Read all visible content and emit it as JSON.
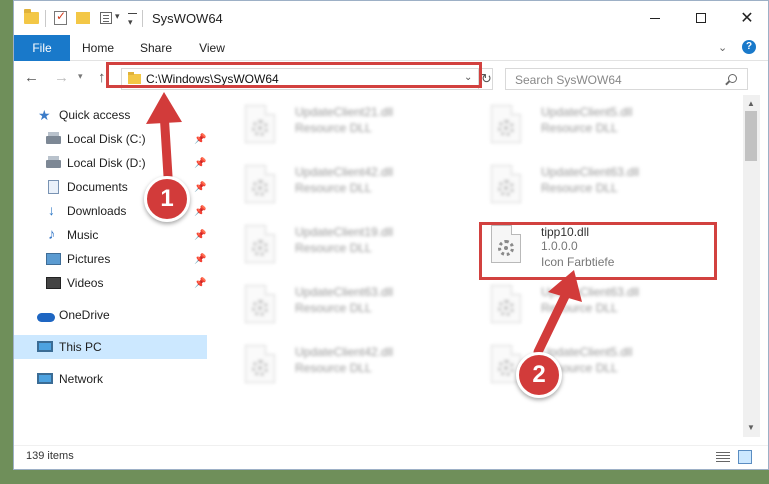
{
  "window": {
    "title": "SysWOW64"
  },
  "ribbon": {
    "tabs": [
      "File",
      "Home",
      "Share",
      "View"
    ],
    "help": "?"
  },
  "nav": {
    "address": "C:\\Windows\\SysWOW64",
    "search_placeholder": "Search SysWOW64"
  },
  "sidebar": {
    "quick_access": "Quick access",
    "pinned": [
      {
        "label": "Local Disk (C:)",
        "icon": "disk-icon"
      },
      {
        "label": "Local Disk (D:)",
        "icon": "disk-icon"
      },
      {
        "label": "Documents",
        "icon": "documents-icon"
      },
      {
        "label": "Downloads",
        "icon": "downloads-icon"
      },
      {
        "label": "Music",
        "icon": "music-icon"
      },
      {
        "label": "Pictures",
        "icon": "pictures-icon"
      },
      {
        "label": "Videos",
        "icon": "videos-icon"
      }
    ],
    "onedrive": "OneDrive",
    "this_pc": "This PC",
    "network": "Network"
  },
  "files": {
    "left": [
      {
        "name": "UpdateClient21.dll",
        "desc": "Resource DLL"
      },
      {
        "name": "UpdateClient42.dll",
        "desc": "Resource DLL"
      },
      {
        "name": "UpdateClient19.dll",
        "desc": "Resource DLL"
      },
      {
        "name": "UpdateClient63.dll",
        "desc": "Resource DLL"
      },
      {
        "name": "UpdateClient42.dll",
        "desc": "Resource DLL"
      }
    ],
    "right": [
      {
        "name": "UpdateClient5.dll",
        "desc": "Resource DLL"
      },
      {
        "name": "UpdateClient63.dll",
        "desc": "Resource DLL"
      },
      {
        "name": "tipp10.dll",
        "version": "1.0.0.0",
        "desc": "Icon Farbtiefe"
      },
      {
        "name": "UpdateClient63.dll",
        "desc": "Resource DLL"
      },
      {
        "name": "UpdateClient5.dll",
        "desc": "Resource DLL"
      }
    ]
  },
  "status": {
    "items": "139 items"
  },
  "markers": [
    "1",
    "2"
  ],
  "colors": {
    "accent": "#1979ca",
    "callout": "#d2413f",
    "selected": "#cce8ff"
  }
}
